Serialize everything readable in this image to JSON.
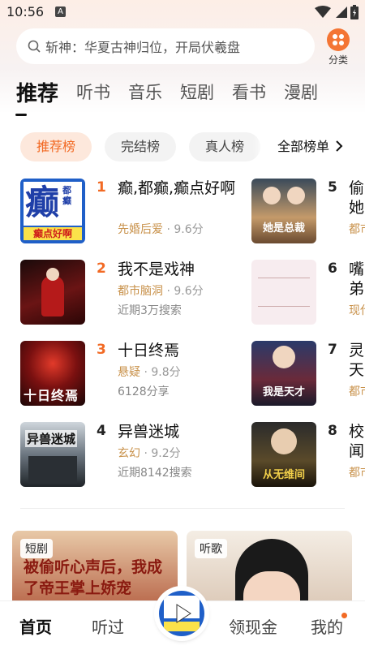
{
  "status": {
    "time": "10:56",
    "a_icon": "A"
  },
  "search": {
    "placeholder": "斩神：华夏古神归位，开局伏羲盘"
  },
  "category": {
    "label": "分类"
  },
  "tabs": [
    "推荐",
    "听书",
    "音乐",
    "短剧",
    "看书",
    "漫剧"
  ],
  "chips": [
    "推荐榜",
    "完结榜",
    "真人榜"
  ],
  "chip_all": "全部榜单",
  "rankings": [
    {
      "rank": "1",
      "title": "癫,都癫,癫点好啊",
      "tag": "先婚后爱",
      "score": " · 9.6分",
      "extra": ""
    },
    {
      "rank": "2",
      "title": "我不是戏神",
      "tag": "都市脑洞",
      "score": " · 9.6分",
      "extra": "近期3万搜索"
    },
    {
      "rank": "3",
      "title": "十日终焉",
      "tag": "悬疑",
      "score": " · 9.8分",
      "extra": "6128分享"
    },
    {
      "rank": "4",
      "title": "异兽迷城",
      "tag": "玄幻",
      "score": " · 9.2分",
      "extra": "近期8142搜索"
    },
    {
      "rank": "5",
      "title": "偷她",
      "tag": "都市",
      "score": "",
      "extra": ""
    },
    {
      "rank": "6",
      "title": "嘴弟",
      "tag": "现代",
      "score": "",
      "extra": ""
    },
    {
      "rank": "7",
      "title": "灵天",
      "tag": "都市",
      "score": "",
      "extra": ""
    },
    {
      "rank": "8",
      "title": "校闻",
      "tag": "都市",
      "score": "",
      "extra": ""
    }
  ],
  "covers": {
    "c1_big": "癫",
    "c1_small": "都癫",
    "c1_bottom": "癫点好啊",
    "c3": "十日终焉",
    "c4": "异兽迷城",
    "c5": "她是总裁",
    "c7": "我是天才",
    "c8": "从无维间"
  },
  "cards": [
    {
      "tag": "短剧",
      "text": "被偷听心声后，我成了帝王掌上娇宠"
    },
    {
      "tag": "听歌",
      "text": ""
    }
  ],
  "nav": [
    "首页",
    "听过",
    "领现金",
    "我的"
  ],
  "colors": {
    "accent": "#f26a24",
    "tag": "#c8914a"
  }
}
